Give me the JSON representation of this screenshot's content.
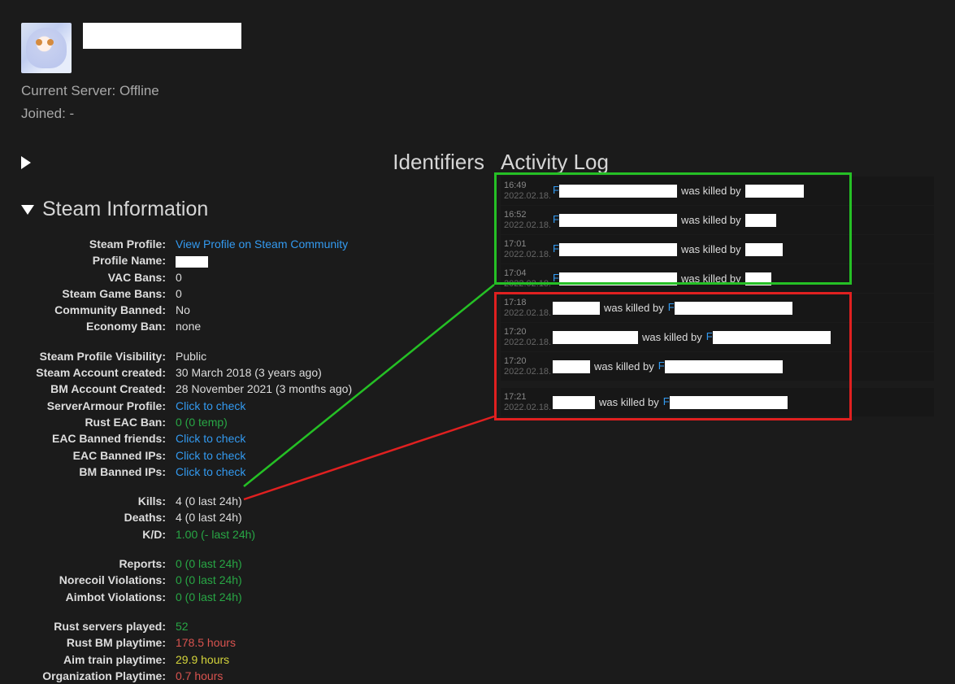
{
  "header": {
    "current_server_label": "Current Server: ",
    "current_server_value": "Offline",
    "joined_label": "Joined: -"
  },
  "sections": {
    "identifiers": "Identifiers",
    "steam_info": "Steam Information",
    "activity_log": "Activity Log"
  },
  "steam_info_groups": [
    [
      {
        "label": "Steam Profile:",
        "value": "View Profile on Steam Community",
        "cls": "link",
        "link": true
      },
      {
        "label": "Profile Name:",
        "value": "",
        "redact": 40
      },
      {
        "label": "VAC Bans:",
        "value": "0"
      },
      {
        "label": "Steam Game Bans:",
        "value": "0"
      },
      {
        "label": "Community Banned:",
        "value": "No"
      },
      {
        "label": "Economy Ban:",
        "value": "none"
      }
    ],
    [
      {
        "label": "Steam Profile Visibility:",
        "value": "Public"
      },
      {
        "label": "Steam Account created:",
        "value": "30 March 2018 (3 years ago)"
      },
      {
        "label": "BM Account Created:",
        "value": "28 November 2021 (3 months ago)"
      },
      {
        "label": "ServerArmour Profile:",
        "value": "Click to check",
        "cls": "link",
        "link": true
      },
      {
        "label": "Rust EAC Ban:",
        "value": "0 (0 temp)",
        "cls": "green"
      },
      {
        "label": "EAC Banned friends:",
        "value": "Click to check",
        "cls": "link",
        "link": true
      },
      {
        "label": "EAC Banned IPs:",
        "value": "Click to check",
        "cls": "link",
        "link": true
      },
      {
        "label": "BM Banned IPs:",
        "value": "Click to check",
        "cls": "link",
        "link": true
      }
    ],
    [
      {
        "label": "Kills:",
        "value": "4 (0 last 24h)",
        "id": "kills"
      },
      {
        "label": "Deaths:",
        "value": "4 (0 last 24h)",
        "id": "deaths"
      },
      {
        "label": "K/D:",
        "value": "1.00 (- last 24h)",
        "cls": "green"
      }
    ],
    [
      {
        "label": "Reports:",
        "value": "0 (0 last 24h)",
        "cls": "green"
      },
      {
        "label": "Norecoil Violations:",
        "value": "0 (0 last 24h)",
        "cls": "green"
      },
      {
        "label": "Aimbot Violations:",
        "value": "0 (0 last 24h)",
        "cls": "green"
      }
    ],
    [
      {
        "label": "Rust servers played:",
        "value": "52",
        "cls": "green"
      },
      {
        "label": "Rust BM playtime:",
        "value": "178.5 hours",
        "cls": "orange"
      },
      {
        "label": "Aim train playtime:",
        "value": "29.9 hours",
        "cls": "yellow"
      },
      {
        "label": "Organization Playtime:",
        "value": "0.7 hours",
        "cls": "orange"
      }
    ]
  ],
  "log_entries": [
    {
      "time": "16:49",
      "date": "2022.02.18.",
      "type": "kill",
      "subj_f": true,
      "subj_w": 145,
      "mid": "was killed by",
      "obj_f": false,
      "obj_w": 72
    },
    {
      "time": "16:52",
      "date": "2022.02.18.",
      "type": "kill",
      "subj_f": true,
      "subj_w": 145,
      "mid": "was killed by",
      "obj_f": false,
      "obj_w": 38
    },
    {
      "time": "17:01",
      "date": "2022.02.18.",
      "type": "kill",
      "subj_f": true,
      "subj_w": 145,
      "mid": "was killed by",
      "obj_f": false,
      "obj_w": 46
    },
    {
      "time": "17:04",
      "date": "2022.02.18.",
      "type": "kill",
      "subj_f": true,
      "subj_w": 145,
      "mid": "was killed by",
      "obj_f": false,
      "obj_w": 32
    },
    {
      "time": "17:18",
      "date": "2022.02.18.",
      "type": "death",
      "subj_f": false,
      "subj_w": 58,
      "mid": "was killed by",
      "obj_f": true,
      "obj_w": 145
    },
    {
      "time": "17:20",
      "date": "2022.02.18.",
      "type": "death",
      "subj_f": false,
      "subj_w": 105,
      "mid": "was killed by",
      "obj_f": true,
      "obj_w": 145
    },
    {
      "time": "17:20",
      "date": "2022.02.18.",
      "type": "death",
      "subj_f": false,
      "subj_w": 46,
      "mid": "was killed by",
      "obj_f": true,
      "obj_w": 145
    },
    {
      "time": "17:21",
      "date": "2022.02.18.",
      "type": "death",
      "subj_f": false,
      "subj_w": 52,
      "mid": "was killed by",
      "obj_f": true,
      "obj_w": 145
    }
  ]
}
